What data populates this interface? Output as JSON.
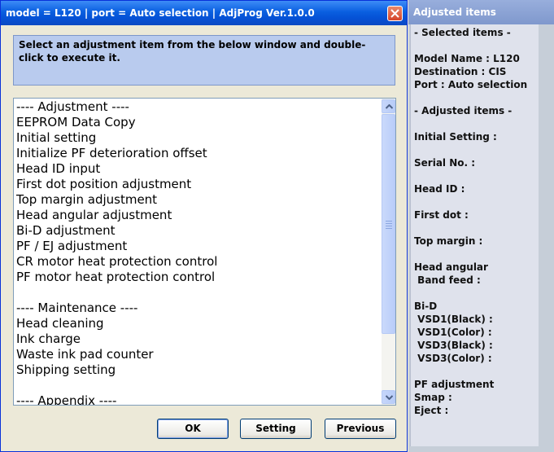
{
  "window": {
    "title": "model = L120 | port = Auto selection | AdjProg Ver.1.0.0",
    "instruction": "Select an adjustment item from the below window and double-click to execute it."
  },
  "list": {
    "items": [
      "---- Adjustment ----",
      "EEPROM Data Copy",
      "Initial setting",
      "Initialize PF deterioration offset",
      "Head ID input",
      "First dot position adjustment",
      "Top margin adjustment",
      "Head angular adjustment",
      "Bi-D adjustment",
      "PF / EJ adjustment",
      "CR motor heat protection control",
      "PF motor heat protection control",
      "",
      "---- Maintenance ----",
      "Head cleaning",
      "Ink charge",
      "Waste ink pad counter",
      "Shipping setting",
      "",
      "---- Appendix ----"
    ]
  },
  "buttons": {
    "ok": "OK",
    "setting": "Setting",
    "previous": "Previous"
  },
  "side": {
    "title": "Adjusted items",
    "lines": [
      "- Selected items -",
      "",
      "Model Name : L120",
      "Destination : CIS",
      "Port : Auto selection",
      "",
      "- Adjusted items -",
      "",
      "Initial Setting :",
      "",
      "Serial No. :",
      "",
      "Head ID :",
      "",
      "First dot :",
      "",
      "Top margin :",
      "",
      "Head angular",
      " Band feed :",
      "",
      "Bi-D",
      " VSD1(Black) :",
      " VSD1(Color) :",
      " VSD3(Black) :",
      " VSD3(Color) :",
      "",
      "PF adjustment",
      "Smap :",
      "Eject :"
    ]
  },
  "colors": {
    "titlebar": "#0552d6",
    "instruction_bg": "#b9cbee",
    "side_panel": "#dfe2ec"
  },
  "icons": {
    "close": "close-icon",
    "scroll_up": "chevron-up-icon",
    "scroll_down": "chevron-down-icon"
  }
}
